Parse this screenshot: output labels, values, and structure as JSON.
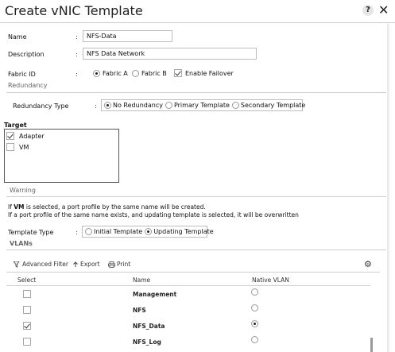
{
  "dialog": {
    "title": "Create vNIC Template",
    "help_glyph": "?",
    "close_glyph": "✕"
  },
  "form": {
    "name_label": "Name",
    "name_value": "NFS-Data",
    "description_label": "Description",
    "description_value": "NFS Data Network",
    "fabric_label": "Fabric ID",
    "fabric_colon": ":",
    "fabric_a": "Fabric A",
    "fabric_b": "Fabric B",
    "fabric_selected": "Fabric A",
    "enable_failover": "Enable Failover",
    "enable_failover_checked": true,
    "redundancy_section": "Redundancy",
    "redundancy_type_label": "Redundancy Type",
    "redundancy_colon": ":",
    "redundancy_options": [
      "No Redundancy",
      "Primary Template",
      "Secondary Template"
    ],
    "redundancy_selected": "No Redundancy"
  },
  "target": {
    "label": "Target",
    "items": [
      {
        "label": "Adapter",
        "checked": true
      },
      {
        "label": "VM",
        "checked": false
      }
    ]
  },
  "warning": {
    "section": "Warning",
    "line1_prefix": "If ",
    "line1_bold": "VM",
    "line1_rest": " is selected, a port profile by the same name will be created.",
    "line2": "If a port profile of the same name exists, and updating template is selected, it will be overwritten"
  },
  "template_type": {
    "label": "Template Type",
    "colon": ":",
    "options": [
      "Initial Template",
      "Updating Template"
    ],
    "selected": "Updating Template"
  },
  "vlans": {
    "section": "VLANs",
    "toolbar": {
      "advanced_filter": "Advanced Filter",
      "export": "Export",
      "print": "Print"
    },
    "columns": [
      "Select",
      "Name",
      "Native VLAN"
    ],
    "rows": [
      {
        "name": "Management",
        "selected": false,
        "native": false
      },
      {
        "name": "NFS",
        "selected": false,
        "native": false
      },
      {
        "name": "NFS_Data",
        "selected": true,
        "native": true
      },
      {
        "name": "NFS_Log",
        "selected": false,
        "native": false
      }
    ]
  }
}
